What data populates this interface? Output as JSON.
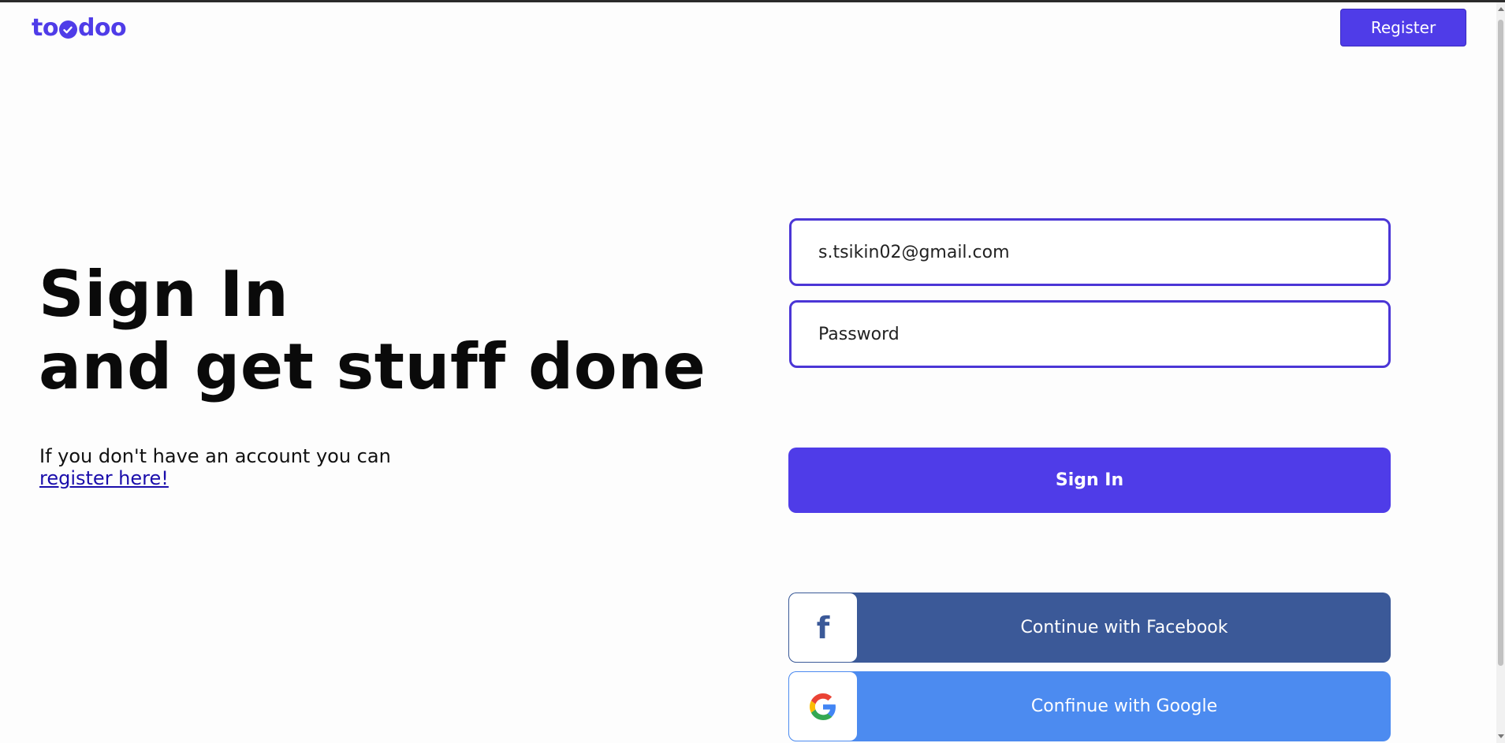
{
  "brand": {
    "logo_prefix": "to",
    "logo_suffix": "doo",
    "accent_color": "#4f3ce8"
  },
  "header": {
    "register_label": "Register"
  },
  "hero": {
    "title_line1": "Sign In",
    "title_line2": "and get stuff done",
    "hint_text": "If you don't have an account you can",
    "hint_link": "register here!"
  },
  "form": {
    "email_value": "s.tsikin02@gmail.com",
    "password_placeholder": "Password",
    "signin_label": "Sign In"
  },
  "social": {
    "facebook_label": "Continue with Facebook",
    "facebook_icon": "facebook-icon",
    "facebook_color": "#3b5998",
    "google_label": "Confinue with Google",
    "google_icon": "google-icon",
    "google_color": "#4c8bf0"
  }
}
